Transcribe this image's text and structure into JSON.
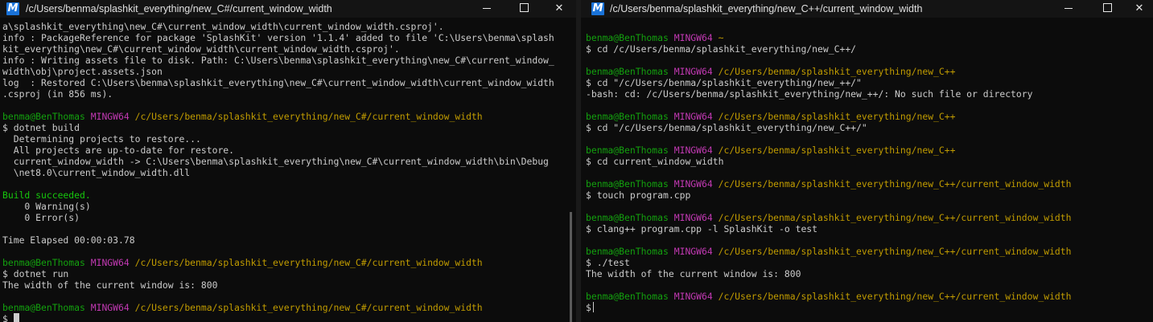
{
  "left_window": {
    "title": "/c/Users/benma/splashkit_everything/new_C#/current_window_width",
    "icon": "mingw-m-icon",
    "icon_glyph": "M",
    "controls": {
      "minimize": "minimize",
      "maximize": "maximize",
      "close": "✕"
    },
    "lines": [
      {
        "segments": [
          {
            "t": "a\\splashkit_everything\\new_C#\\current_window_width\\current_window_width.csproj'.",
            "c": ""
          }
        ]
      },
      {
        "segments": [
          {
            "t": "info : PackageReference for package 'SplashKit' version '1.1.4' added to file 'C:\\Users\\benma\\splash",
            "c": ""
          }
        ]
      },
      {
        "segments": [
          {
            "t": "kit_everything\\new_C#\\current_window_width\\current_window_width.csproj'.",
            "c": ""
          }
        ]
      },
      {
        "segments": [
          {
            "t": "info : Writing assets file to disk. Path: C:\\Users\\benma\\splashkit_everything\\new_C#\\current_window_",
            "c": ""
          }
        ]
      },
      {
        "segments": [
          {
            "t": "width\\obj\\project.assets.json",
            "c": ""
          }
        ]
      },
      {
        "segments": [
          {
            "t": "log  : Restored C:\\Users\\benma\\splashkit_everything\\new_C#\\current_window_width\\current_window_width",
            "c": ""
          }
        ]
      },
      {
        "segments": [
          {
            "t": ".csproj (in 856 ms).",
            "c": ""
          }
        ]
      },
      {
        "segments": [
          {
            "t": "",
            "c": ""
          }
        ]
      },
      {
        "segments": [
          {
            "t": "benma@BenThomas",
            "c": "bg"
          },
          {
            "t": " ",
            "c": ""
          },
          {
            "t": "MINGW64",
            "c": "p"
          },
          {
            "t": " ",
            "c": ""
          },
          {
            "t": "/c/Users/benma/splashkit_everything/new_C#/current_window_width",
            "c": "y"
          }
        ]
      },
      {
        "segments": [
          {
            "t": "$ dotnet build",
            "c": ""
          }
        ]
      },
      {
        "segments": [
          {
            "t": "  Determining projects to restore...",
            "c": ""
          }
        ]
      },
      {
        "segments": [
          {
            "t": "  All projects are up-to-date for restore.",
            "c": ""
          }
        ]
      },
      {
        "segments": [
          {
            "t": "  current_window_width -> C:\\Users\\benma\\splashkit_everything\\new_C#\\current_window_width\\bin\\Debug",
            "c": ""
          }
        ]
      },
      {
        "segments": [
          {
            "t": "  \\net8.0\\current_window_width.dll",
            "c": ""
          }
        ]
      },
      {
        "segments": [
          {
            "t": "",
            "c": ""
          }
        ]
      },
      {
        "segments": [
          {
            "t": "Build succeeded.",
            "c": "g"
          }
        ]
      },
      {
        "segments": [
          {
            "t": "    0 Warning(s)",
            "c": ""
          }
        ]
      },
      {
        "segments": [
          {
            "t": "    0 Error(s)",
            "c": ""
          }
        ]
      },
      {
        "segments": [
          {
            "t": "",
            "c": ""
          }
        ]
      },
      {
        "segments": [
          {
            "t": "Time Elapsed 00:00:03.78",
            "c": ""
          }
        ]
      },
      {
        "segments": [
          {
            "t": "",
            "c": ""
          }
        ]
      },
      {
        "segments": [
          {
            "t": "benma@BenThomas",
            "c": "bg"
          },
          {
            "t": " ",
            "c": ""
          },
          {
            "t": "MINGW64",
            "c": "p"
          },
          {
            "t": " ",
            "c": ""
          },
          {
            "t": "/c/Users/benma/splashkit_everything/new_C#/current_window_width",
            "c": "y"
          }
        ]
      },
      {
        "segments": [
          {
            "t": "$ dotnet run",
            "c": ""
          }
        ]
      },
      {
        "segments": [
          {
            "t": "The width of the current window is: 800",
            "c": ""
          }
        ]
      },
      {
        "segments": [
          {
            "t": "",
            "c": ""
          }
        ]
      },
      {
        "segments": [
          {
            "t": "benma@BenThomas",
            "c": "bg"
          },
          {
            "t": " ",
            "c": ""
          },
          {
            "t": "MINGW64",
            "c": "p"
          },
          {
            "t": " ",
            "c": ""
          },
          {
            "t": "/c/Users/benma/splashkit_everything/new_C#/current_window_width",
            "c": "y"
          }
        ]
      },
      {
        "segments": [
          {
            "t": "$ ",
            "c": ""
          }
        ],
        "cursor": "block"
      }
    ]
  },
  "right_window": {
    "title": "/c/Users/benma/splashkit_everything/new_C++/current_window_width",
    "icon": "mingw-m-icon",
    "icon_glyph": "M",
    "controls": {
      "minimize": "minimize",
      "maximize": "maximize",
      "close": "✕"
    },
    "lines": [
      {
        "segments": [
          {
            "t": "benma@BenThomas",
            "c": "bg"
          },
          {
            "t": " ",
            "c": ""
          },
          {
            "t": "MINGW64",
            "c": "p"
          },
          {
            "t": " ",
            "c": ""
          },
          {
            "t": "~",
            "c": "y"
          }
        ]
      },
      {
        "segments": [
          {
            "t": "$ cd /c/Users/benma/splashkit_everything/new_C++/",
            "c": ""
          }
        ]
      },
      {
        "segments": [
          {
            "t": "",
            "c": ""
          }
        ]
      },
      {
        "segments": [
          {
            "t": "benma@BenThomas",
            "c": "bg"
          },
          {
            "t": " ",
            "c": ""
          },
          {
            "t": "MINGW64",
            "c": "p"
          },
          {
            "t": " ",
            "c": ""
          },
          {
            "t": "/c/Users/benma/splashkit_everything/new_C++",
            "c": "y"
          }
        ]
      },
      {
        "segments": [
          {
            "t": "$ cd \"/c/Users/benma/splashkit_everything/new_++/\"",
            "c": ""
          }
        ]
      },
      {
        "segments": [
          {
            "t": "-bash: cd: /c/Users/benma/splashkit_everything/new_++/: No such file or directory",
            "c": ""
          }
        ]
      },
      {
        "segments": [
          {
            "t": "",
            "c": ""
          }
        ]
      },
      {
        "segments": [
          {
            "t": "benma@BenThomas",
            "c": "bg"
          },
          {
            "t": " ",
            "c": ""
          },
          {
            "t": "MINGW64",
            "c": "p"
          },
          {
            "t": " ",
            "c": ""
          },
          {
            "t": "/c/Users/benma/splashkit_everything/new_C++",
            "c": "y"
          }
        ]
      },
      {
        "segments": [
          {
            "t": "$ cd \"/c/Users/benma/splashkit_everything/new_C++/\"",
            "c": ""
          }
        ]
      },
      {
        "segments": [
          {
            "t": "",
            "c": ""
          }
        ]
      },
      {
        "segments": [
          {
            "t": "benma@BenThomas",
            "c": "bg"
          },
          {
            "t": " ",
            "c": ""
          },
          {
            "t": "MINGW64",
            "c": "p"
          },
          {
            "t": " ",
            "c": ""
          },
          {
            "t": "/c/Users/benma/splashkit_everything/new_C++",
            "c": "y"
          }
        ]
      },
      {
        "segments": [
          {
            "t": "$ cd current_window_width",
            "c": ""
          }
        ]
      },
      {
        "segments": [
          {
            "t": "",
            "c": ""
          }
        ]
      },
      {
        "segments": [
          {
            "t": "benma@BenThomas",
            "c": "bg"
          },
          {
            "t": " ",
            "c": ""
          },
          {
            "t": "MINGW64",
            "c": "p"
          },
          {
            "t": " ",
            "c": ""
          },
          {
            "t": "/c/Users/benma/splashkit_everything/new_C++/current_window_width",
            "c": "y"
          }
        ]
      },
      {
        "segments": [
          {
            "t": "$ touch program.cpp",
            "c": ""
          }
        ]
      },
      {
        "segments": [
          {
            "t": "",
            "c": ""
          }
        ]
      },
      {
        "segments": [
          {
            "t": "benma@BenThomas",
            "c": "bg"
          },
          {
            "t": " ",
            "c": ""
          },
          {
            "t": "MINGW64",
            "c": "p"
          },
          {
            "t": " ",
            "c": ""
          },
          {
            "t": "/c/Users/benma/splashkit_everything/new_C++/current_window_width",
            "c": "y"
          }
        ]
      },
      {
        "segments": [
          {
            "t": "$ clang++ program.cpp -l SplashKit -o test",
            "c": ""
          }
        ]
      },
      {
        "segments": [
          {
            "t": "",
            "c": ""
          }
        ]
      },
      {
        "segments": [
          {
            "t": "benma@BenThomas",
            "c": "bg"
          },
          {
            "t": " ",
            "c": ""
          },
          {
            "t": "MINGW64",
            "c": "p"
          },
          {
            "t": " ",
            "c": ""
          },
          {
            "t": "/c/Users/benma/splashkit_everything/new_C++/current_window_width",
            "c": "y"
          }
        ]
      },
      {
        "segments": [
          {
            "t": "$ ./test",
            "c": ""
          }
        ]
      },
      {
        "segments": [
          {
            "t": "The width of the current window is: 800",
            "c": ""
          }
        ]
      },
      {
        "segments": [
          {
            "t": "",
            "c": ""
          }
        ]
      },
      {
        "segments": [
          {
            "t": "benma@BenThomas",
            "c": "bg"
          },
          {
            "t": " ",
            "c": ""
          },
          {
            "t": "MINGW64",
            "c": "p"
          },
          {
            "t": " ",
            "c": ""
          },
          {
            "t": "/c/Users/benma/splashkit_everything/new_C++/current_window_width",
            "c": "y"
          }
        ]
      },
      {
        "segments": [
          {
            "t": "$",
            "c": ""
          }
        ],
        "cursor": "bar"
      }
    ]
  },
  "colors": {
    "background": "#0c0c0c",
    "titlebar": "#141414",
    "text": "#cccccc",
    "user_host": "#13a10e",
    "mingw": "#c239b3",
    "path": "#c19c00",
    "success": "#16c60c"
  }
}
